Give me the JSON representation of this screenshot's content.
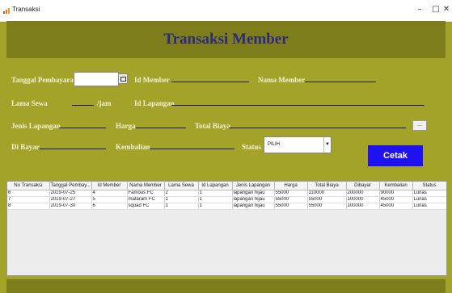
{
  "window": {
    "title": "Transaksi",
    "minimize": "–",
    "maximize": "□",
    "close": "✕"
  },
  "header": {
    "title": "Transaksi Member"
  },
  "form": {
    "tanggal_label": "Tanggal Pembayaran",
    "id_member_label": "Id Member",
    "nama_member_label": "Nama Member",
    "lama_sewa_label": "Lama Sewa",
    "jam_unit": "/jam",
    "id_lapangan_label": "Id Lapangan",
    "jenis_lapangan_label": "Jenis Lapangan",
    "harga_label": "Harga",
    "total_biaya_label": "Total Biaya",
    "small_button_label": "...",
    "di_bayar_label": "Di Bayar",
    "kembalian_label": "Kembalian",
    "status_label": "Status",
    "status_selected": "PILIH",
    "cetak_label": "Cetak"
  },
  "table": {
    "columns": [
      "No Transaksi",
      "Tanggal Pembay...",
      "Id Member",
      "Nama Member",
      "Lama Sewa",
      "Id Lapangan",
      "Jenis Lapangan",
      "Harga",
      "Total Biaya",
      "Dibayar",
      "Kembalian",
      "Status"
    ],
    "rows": [
      [
        "6",
        "2019-07-25",
        "4",
        "Famous FC",
        "2",
        "1",
        "lapangan hijau",
        "55000",
        "110000",
        "200000",
        "90000",
        "Lunas"
      ],
      [
        "7",
        "2019-07-27",
        "5",
        "mataram FC",
        "1",
        "1",
        "lapangan hijau",
        "55000",
        "55000",
        "100000",
        "45000",
        "Lunas"
      ],
      [
        "8",
        "2019-07-30",
        "6",
        "squad FC",
        "1",
        "1",
        "lapangan hijau",
        "55000",
        "55000",
        "100000",
        "45000",
        "Lunas"
      ]
    ]
  },
  "colors": {
    "background": "#a3a32a",
    "header": "#7d7d1c",
    "title": "#2b2b7a",
    "cetak": "#1f12f2"
  }
}
